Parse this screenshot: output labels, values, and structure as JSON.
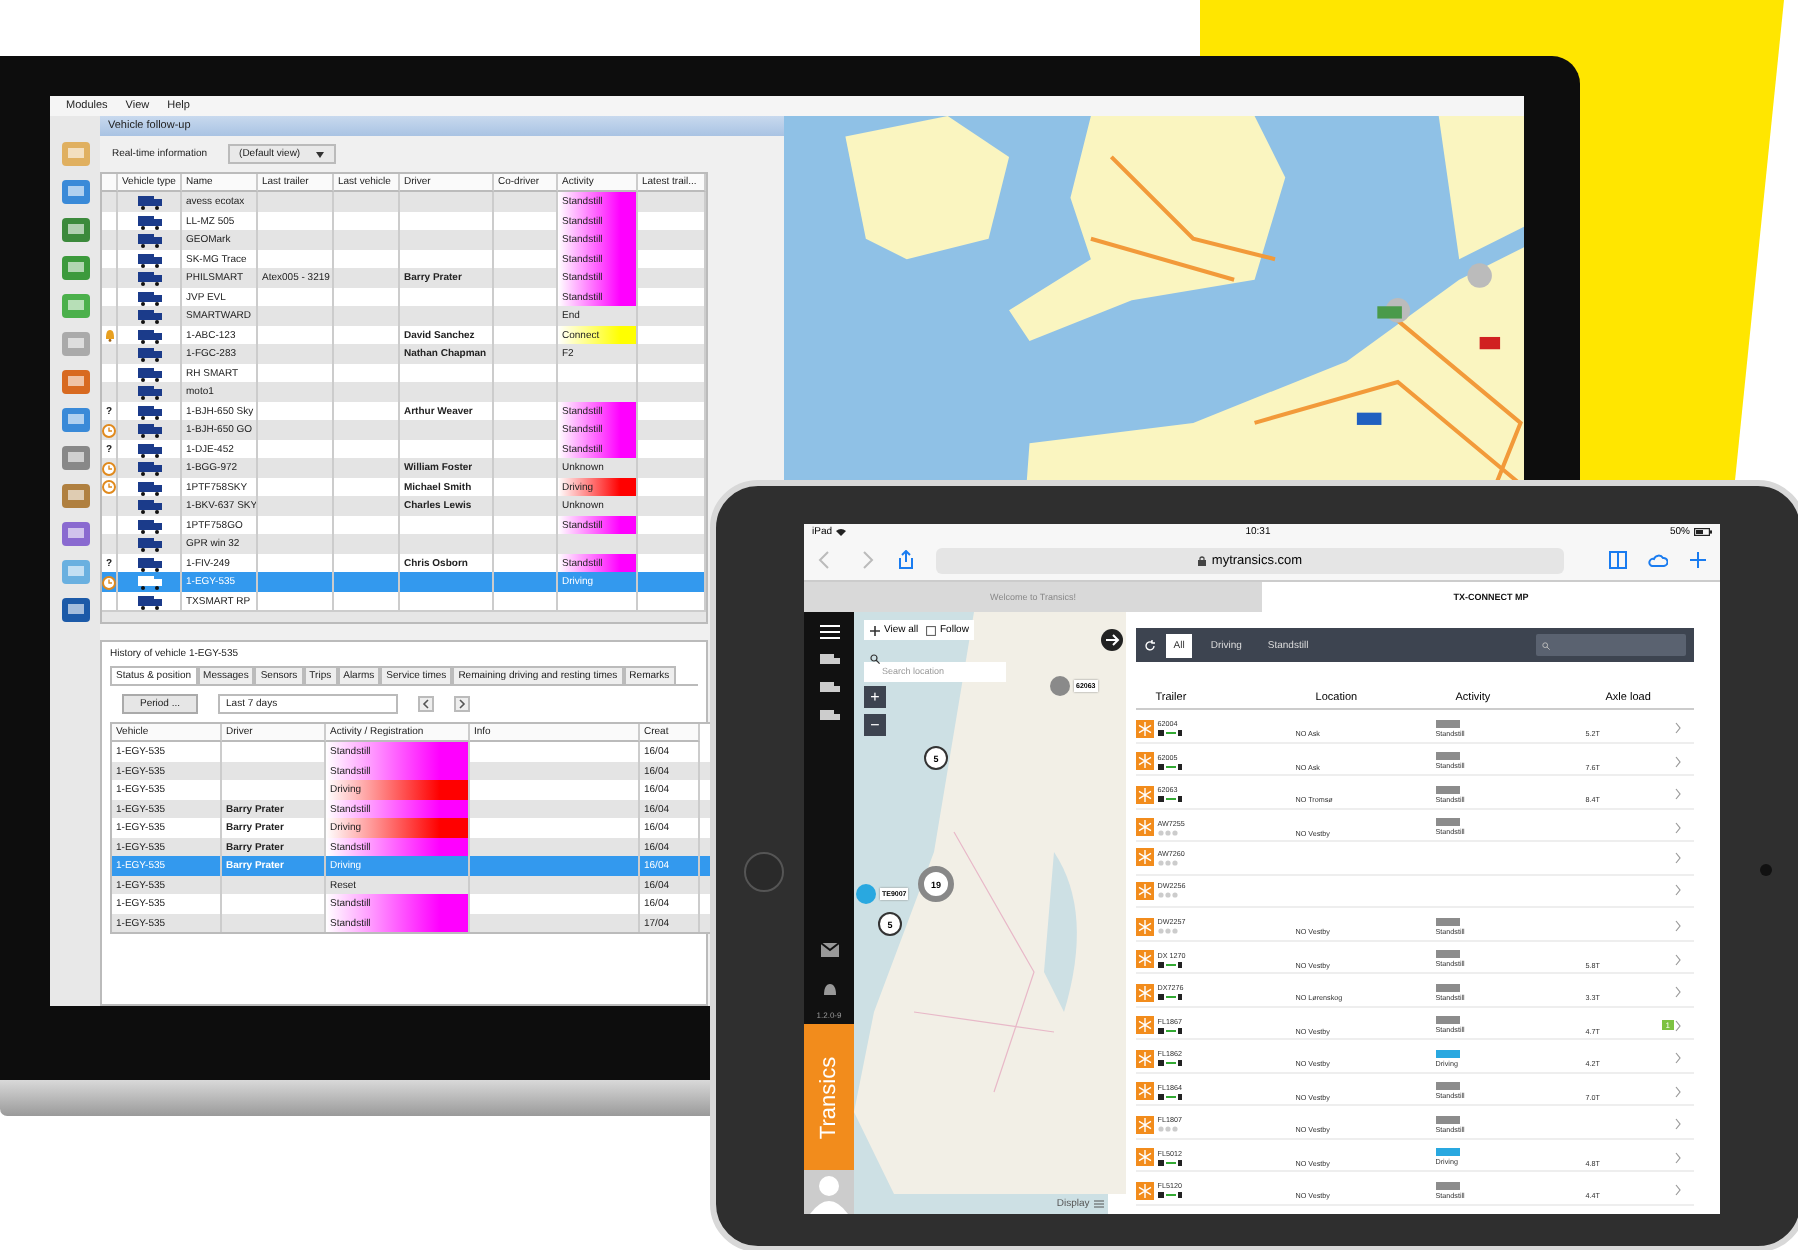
{
  "laptop": {
    "menu": [
      "Modules",
      "View",
      "Help"
    ],
    "window_title": "Vehicle follow-up",
    "realtime": {
      "label": "Real-time information",
      "view": "(Default view)"
    },
    "vehicles": {
      "columns": [
        "Vehicle type",
        "Name",
        "Last trailer",
        "Last vehicle",
        "Driver",
        "Co-driver",
        "Activity",
        "Latest trail..."
      ],
      "rows": [
        {
          "name": "avess ecotax",
          "activity": "Standstill",
          "color": "#ff00ff",
          "selected": false
        },
        {
          "name": "LL-MZ 505",
          "activity": "Standstill",
          "color": "#ff00ff",
          "selected": false
        },
        {
          "name": "GEOMark",
          "activity": "Standstill",
          "color": "#ff00ff",
          "selected": false
        },
        {
          "name": "SK-MG Trace",
          "activity": "Standstill",
          "color": "#ff00ff",
          "selected": false
        },
        {
          "name": "PHILSMART",
          "trailer": "Atex005 - 3219",
          "driver": "Barry Prater",
          "activity": "Standstill",
          "color": "#ff00ff",
          "selected": false
        },
        {
          "name": "JVP EVL",
          "activity": "Standstill",
          "color": "#ff00ff",
          "selected": false
        },
        {
          "name": "SMARTWARD",
          "activity": "End",
          "selected": false
        },
        {
          "kind": "bell",
          "name": "1-ABC-123",
          "driver": "David Sanchez",
          "activity": "Connect",
          "color": "#ffff00",
          "selected": false
        },
        {
          "name": "1-FGC-283",
          "driver": "Nathan Chapman",
          "activity": "F2",
          "selected": false
        },
        {
          "name": "RH SMART",
          "selected": false
        },
        {
          "name": "moto1",
          "selected": false
        },
        {
          "mark": "?",
          "name": "1-BJH-650 Sky",
          "driver": "Arthur Weaver",
          "activity": "Standstill",
          "color": "#ff00ff",
          "selected": false
        },
        {
          "kind": "clock",
          "name": "1-BJH-650 GO",
          "activity": "Standstill",
          "color": "#ff00ff",
          "selected": false
        },
        {
          "mark": "?",
          "name": "1-DJE-452",
          "activity": "Standstill",
          "color": "#ff00ff",
          "selected": false
        },
        {
          "kind": "clock",
          "name": "1-BGG-972",
          "driver": "William Foster",
          "activity": "Unknown",
          "selected": false
        },
        {
          "kind": "clock",
          "name": "1PTF758SKY",
          "driver": "Michael Smith",
          "activity": "Driving",
          "color": "#ff0000",
          "selected": false
        },
        {
          "name": "1-BKV-637 SKY",
          "driver": "Charles Lewis",
          "activity": "Unknown",
          "selected": false
        },
        {
          "name": "1PTF758GO",
          "activity": "Standstill",
          "color": "#ff00ff",
          "selected": false
        },
        {
          "name": "GPR win 32",
          "selected": false
        },
        {
          "mark": "?",
          "name": "1-FIV-249",
          "driver": "Chris Osborn",
          "activity": "Standstill",
          "color": "#ff00ff",
          "selected": false
        },
        {
          "kind": "clock",
          "name": "1-EGY-535",
          "activity": "Driving",
          "selected": true
        },
        {
          "name": "TXSMART RP",
          "selected": false
        }
      ]
    },
    "history": {
      "title": "History of vehicle 1-EGY-535",
      "tabs": [
        {
          "label": "Status & position",
          "selected": true
        },
        {
          "label": "Messages",
          "selected": false
        },
        {
          "label": "Sensors",
          "selected": false
        },
        {
          "label": "Trips",
          "selected": false
        },
        {
          "label": "Alarms",
          "selected": false
        },
        {
          "label": "Service times",
          "selected": false
        },
        {
          "label": "Remaining driving and resting times",
          "selected": false
        },
        {
          "label": "Remarks",
          "selected": false
        }
      ],
      "period_button": "Period ...",
      "period": "Last 7 days",
      "columns": [
        "Vehicle",
        "Driver",
        "Activity / Registration",
        "Info",
        "Creat"
      ],
      "rows": [
        {
          "vehicle": "1-EGY-535",
          "activity": "Standstill",
          "color": "#ff00ff",
          "created": "16/04",
          "selected": false
        },
        {
          "vehicle": "1-EGY-535",
          "activity": "Standstill",
          "color": "#ff00ff",
          "created": "16/04",
          "selected": false
        },
        {
          "vehicle": "1-EGY-535",
          "activity": "Driving",
          "color": "#ff0000",
          "created": "16/04",
          "selected": false
        },
        {
          "vehicle": "1-EGY-535",
          "driver": "Barry Prater",
          "activity": "Standstill",
          "color": "#ff00ff",
          "created": "16/04",
          "selected": false
        },
        {
          "vehicle": "1-EGY-535",
          "driver": "Barry Prater",
          "activity": "Driving",
          "color": "#ff0000",
          "created": "16/04",
          "selected": false
        },
        {
          "vehicle": "1-EGY-535",
          "driver": "Barry Prater",
          "activity": "Standstill",
          "color": "#ff00ff",
          "created": "16/04",
          "selected": false
        },
        {
          "vehicle": "1-EGY-535",
          "driver": "Barry Prater",
          "activity": "Driving",
          "created": "16/04",
          "selected": true
        },
        {
          "vehicle": "1-EGY-535",
          "activity": "Reset",
          "created": "16/04",
          "selected": false
        },
        {
          "vehicle": "1-EGY-535",
          "activity": "Standstill",
          "color": "#ff00ff",
          "created": "16/04",
          "selected": false
        },
        {
          "vehicle": "1-EGY-535",
          "activity": "Standstill",
          "color": "#ff00ff",
          "created": "17/04",
          "selected": false
        }
      ]
    }
  },
  "tablet": {
    "status": {
      "device": "iPad",
      "time": "10:31",
      "battery": "50%"
    },
    "url": "mytransics.com",
    "tabs": [
      {
        "label": "Welcome to Transics!",
        "selected": false
      },
      {
        "label": "TX-CONNECT MP",
        "selected": true
      }
    ],
    "sidebar": {
      "version": "1.2.0-9",
      "brand": "Transics"
    },
    "map": {
      "view_all": "View all",
      "follow": {
        "label": "Follow",
        "checked": false
      },
      "search_placeholder": "Search location",
      "zoom": [
        "+",
        "−"
      ],
      "markers": [
        {
          "kind": "vehicle",
          "label": "62063"
        },
        {
          "kind": "active",
          "label": "TE9007"
        }
      ],
      "clusters": [
        {
          "label": "5",
          "big": false
        },
        {
          "label": "19",
          "big": true
        },
        {
          "label": "5",
          "big": false
        }
      ],
      "display": "Display"
    },
    "filters": [
      {
        "label": "All",
        "selected": true
      },
      {
        "label": "Driving",
        "selected": false
      },
      {
        "label": "Standstill",
        "selected": false
      }
    ],
    "columns": [
      "Trailer",
      "Location",
      "Activity",
      "Axle load"
    ],
    "rows": [
      {
        "trailer": "62004",
        "location": "NO Ask",
        "kind": "standstill",
        "activity": "Standstill",
        "axle": "5.2T",
        "linked": true
      },
      {
        "trailer": "62005",
        "location": "NO Ask",
        "kind": "standstill",
        "activity": "Standstill",
        "axle": "7.6T",
        "linked": true
      },
      {
        "trailer": "62063",
        "location": "NO Tromsø",
        "kind": "standstill",
        "activity": "Standstill",
        "axle": "8.4T",
        "linked": true
      },
      {
        "trailer": "AW7255",
        "location": "NO Vestby",
        "kind": "standstill",
        "activity": "Standstill",
        "linked": false
      },
      {
        "trailer": "AW7260",
        "linked": false
      },
      {
        "trailer": "DW2256",
        "linked": false
      },
      {
        "trailer": "DW2257",
        "location": "NO Vestby",
        "kind": "standstill",
        "activity": "Standstill",
        "linked": false
      },
      {
        "trailer": "DX 1270",
        "location": "NO Vestby",
        "kind": "standstill",
        "activity": "Standstill",
        "axle": "5.8T",
        "linked": true
      },
      {
        "trailer": "DX7276",
        "location": "NO Lørenskog",
        "kind": "standstill",
        "activity": "Standstill",
        "axle": "3.3T",
        "linked": true
      },
      {
        "trailer": "FL1867",
        "location": "NO Vestby",
        "kind": "standstill",
        "activity": "Standstill",
        "axle": "4.7T",
        "alerts": "1",
        "linked": true
      },
      {
        "trailer": "FL1862",
        "location": "NO Vestby",
        "kind": "driving",
        "activity": "Driving",
        "axle": "4.2T",
        "linked": true
      },
      {
        "trailer": "FL1864",
        "location": "NO Vestby",
        "kind": "standstill",
        "activity": "Standstill",
        "axle": "7.0T",
        "linked": true
      },
      {
        "trailer": "FL1807",
        "location": "NO Vestby",
        "kind": "standstill",
        "activity": "Standstill",
        "linked": false
      },
      {
        "trailer": "FL5012",
        "location": "NO Vestby",
        "kind": "driving",
        "activity": "Driving",
        "axle": "4.8T",
        "linked": true
      },
      {
        "trailer": "FL5120",
        "location": "NO Vestby",
        "kind": "standstill",
        "activity": "Standstill",
        "axle": "4.4T",
        "linked": true
      }
    ]
  }
}
